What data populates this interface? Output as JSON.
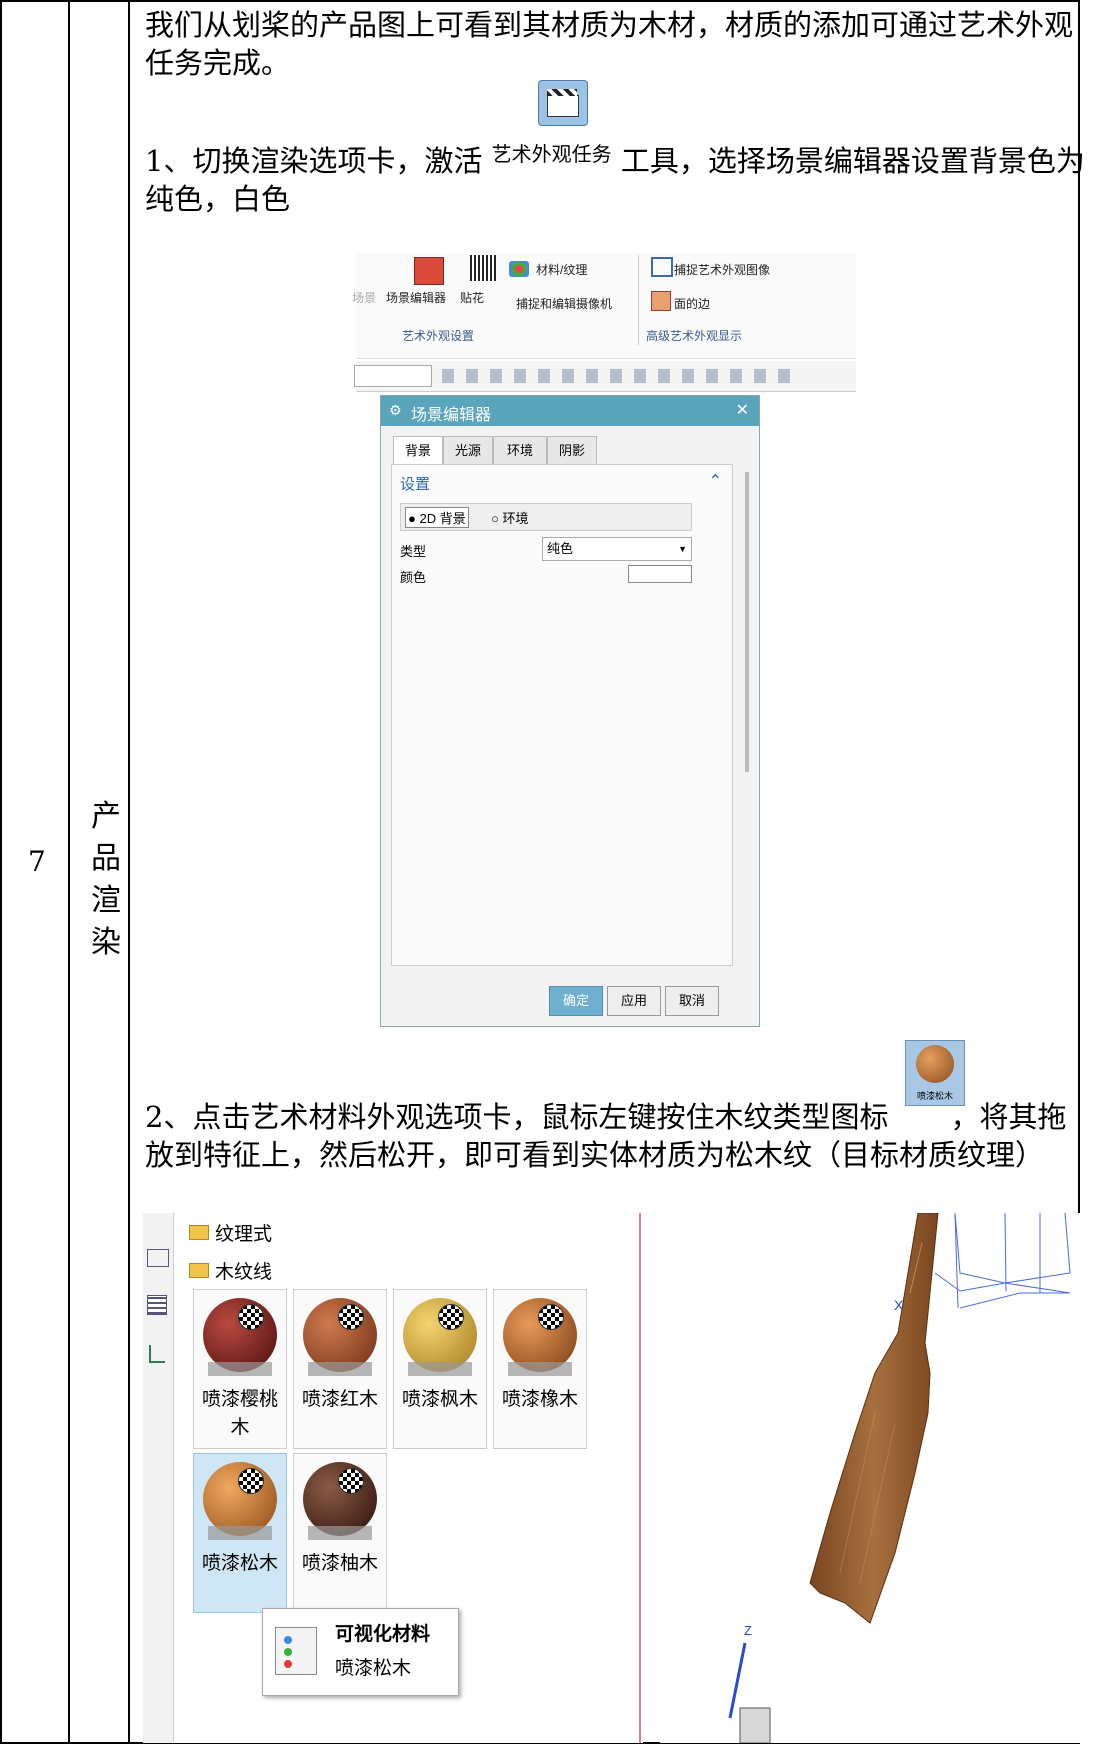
{
  "row": {
    "number": "7",
    "category": "产品渲染"
  },
  "content": {
    "intro": "我们从划桨的产品图上可看到其材质为木材，材质的添加可通过艺术外观任务完成。",
    "step1_a": "1、切换渲染选项卡，激活",
    "step1_tool": "艺术外观任务",
    "step1_b": "工具，选择场景编辑器设置背景色为纯色，白色",
    "step2_a": "2、点击艺术材料外观选项卡，鼠标左键按住木纹类型图标",
    "step2_icon_label": "喷漆松木",
    "step2_b": "，将其拖放到特征上，然后松开，即可看到实体材质为松木纹（目标材质纹理）"
  },
  "ribbon": {
    "btn_scene_editor": "场景编辑器",
    "btn_decal": "贴花",
    "btn_material": "材料/纹理",
    "btn_capture_camera": "捕捉和编辑摄像机",
    "btn_capture_image": "捕捉艺术外观图像",
    "btn_face_edge": "面的边",
    "group_settings": "艺术外观设置",
    "group_advanced": "高级艺术外观显示",
    "left_fragment": "场景"
  },
  "dialog": {
    "title": "场景编辑器",
    "tabs": [
      "背景",
      "光源",
      "环境",
      "阴影"
    ],
    "section": "设置",
    "radio_2d": "2D 背景",
    "radio_env": "环境",
    "type_label": "类型",
    "type_value": "纯色",
    "color_label": "颜色",
    "btn_ok": "确定",
    "btn_apply": "应用",
    "btn_cancel": "取消"
  },
  "library": {
    "folder1": "纹理式",
    "folder2": "木纹线",
    "tiles": [
      "喷漆樱桃木",
      "喷漆红木",
      "喷漆枫木",
      "喷漆橡木",
      "喷漆松木",
      "喷漆柚木"
    ],
    "tooltip_title": "可视化材料",
    "tooltip_value": "喷漆松木"
  },
  "view3d": {
    "axis_x": "X",
    "axis_z": "Z"
  },
  "colors": {
    "dialog_title_bg": "#5aa4bc",
    "ok_button": "#6fb0cf",
    "paddle_wood": "#9b6233",
    "selected_tile": "#cfe6f5"
  }
}
